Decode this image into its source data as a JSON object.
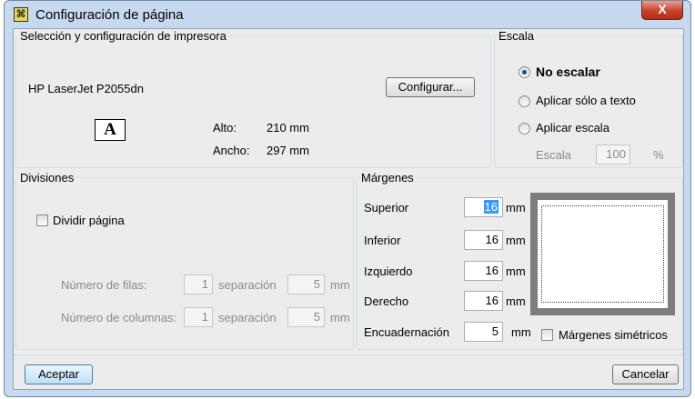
{
  "window": {
    "title": "Configuración de página",
    "close_glyph": "X"
  },
  "printer_group": {
    "legend": "Selección y configuración de impresora",
    "printer_name": "HP LaserJet P2055dn",
    "configure_button": "Configurar...",
    "orientation_icon": "A",
    "height_label": "Alto:",
    "height_value": "210 mm",
    "width_label": "Ancho:",
    "width_value": "297 mm"
  },
  "scale_group": {
    "legend": "Escala",
    "options": [
      "No escalar",
      "Aplicar sólo a texto",
      "Aplicar escala"
    ],
    "selected": "No escalar",
    "scale_label": "Escala",
    "scale_value": "100",
    "scale_unit": "%"
  },
  "divisions_group": {
    "legend": "Divisiones",
    "split_page_label": "Dividir página",
    "rows_label": "Número de filas:",
    "rows_value": "1",
    "rows_sep_label": "separación",
    "rows_sep_value": "5",
    "rows_sep_unit": "mm",
    "cols_label": "Número de columnas:",
    "cols_value": "1",
    "cols_sep_label": "separación",
    "cols_sep_value": "5",
    "cols_sep_unit": "mm"
  },
  "margins_group": {
    "legend": "Márgenes",
    "top_label": "Superior",
    "top_value": "16",
    "top_unit": "mm",
    "bottom_label": "Inferior",
    "bottom_value": "16",
    "bottom_unit": "mm",
    "left_label": "Izquierdo",
    "left_value": "16",
    "left_unit": "mm",
    "right_label": "Derecho",
    "right_value": "16",
    "right_unit": "mm",
    "binding_label": "Encuadernación",
    "binding_value": "5",
    "binding_unit": "mm",
    "symmetric_label": "Márgenes simétricos"
  },
  "footer": {
    "accept_button": "Aceptar",
    "cancel_button": "Cancelar"
  }
}
